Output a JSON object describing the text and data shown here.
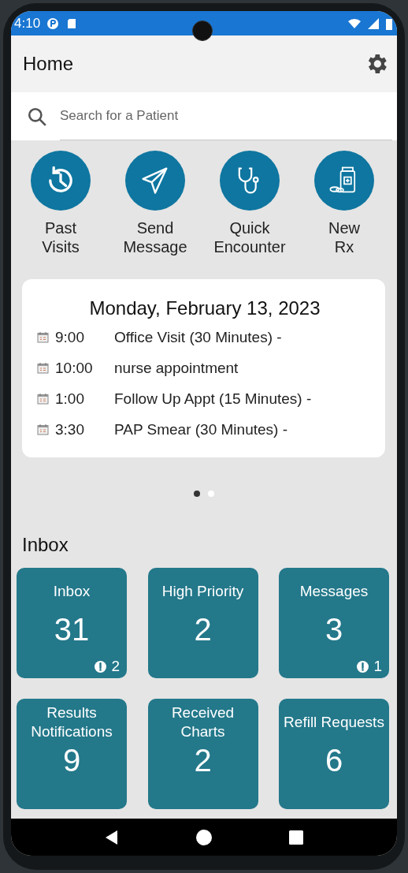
{
  "status_bar": {
    "time": "4:10"
  },
  "app_bar": {
    "title": "Home"
  },
  "search": {
    "placeholder": "Search for a Patient"
  },
  "quick_actions": [
    {
      "kind": "history",
      "label": "Past\nVisits"
    },
    {
      "kind": "send",
      "label": "Send\nMessage"
    },
    {
      "kind": "stethoscope",
      "label": "Quick\nEncounter"
    },
    {
      "kind": "prescription",
      "label": "New\nRx"
    }
  ],
  "schedule": {
    "date": "Monday, February 13, 2023",
    "appointments": [
      {
        "time": "9:00",
        "description": "Office Visit (30 Minutes) -"
      },
      {
        "time": "10:00",
        "description": "nurse appointment"
      },
      {
        "time": "1:00",
        "description": "Follow Up Appt (15 Minutes) -"
      },
      {
        "time": "3:30",
        "description": "PAP Smear (30 Minutes) -"
      }
    ]
  },
  "pager_dots": [
    {
      "selected": true
    },
    {
      "selected": false
    }
  ],
  "inbox": {
    "heading": "Inbox",
    "tiles": [
      {
        "title": "Inbox",
        "count": "31",
        "urgent": "2"
      },
      {
        "title": "High Priority",
        "count": "2"
      },
      {
        "title": "Messages",
        "count": "3",
        "urgent": "1"
      },
      {
        "title": "Results Notifications",
        "count": "9"
      },
      {
        "title": "Received Charts",
        "count": "2"
      },
      {
        "title": "Refill Requests",
        "count": "6"
      }
    ]
  }
}
